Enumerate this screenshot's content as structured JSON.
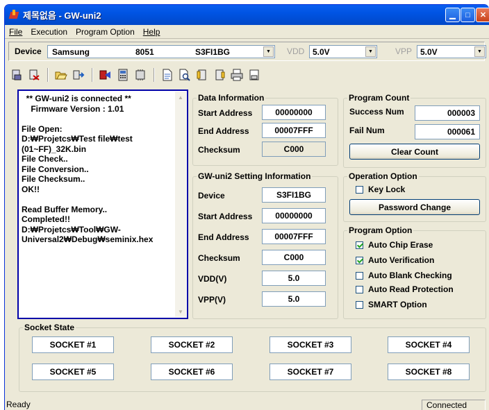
{
  "window": {
    "title": "제목없음 - GW-uni2"
  },
  "menu": [
    "File",
    "Execution",
    "Program Option",
    "Help"
  ],
  "device_bar": {
    "label": "Device",
    "manufacturer": "Samsung",
    "family": "8051",
    "device": "S3FI1BG",
    "vdd_label": "VDD",
    "vdd_value": "5.0V",
    "vpp_label": "VPP",
    "vpp_value": "5.0V"
  },
  "toolbar_icons": [
    "read-chip-icon",
    "erase-icon",
    "open-file-icon",
    "load-icon",
    "program-icon",
    "calculator-icon",
    "memory-icon",
    "document-icon",
    "search-doc-icon",
    "verify-icon",
    "protect-icon",
    "print-icon",
    "save-icon"
  ],
  "log": {
    "text": "  ** GW-uni2 is connected **\n    Firmware Version : 1.01\n\nFile Open:\nD:₩Projetcs₩Test file₩test\n(01~FF)_32K.bin\nFile Check..\nFile Conversion..\nFile Checksum..\nOK!!\n\nRead Buffer Memory..\nCompleted!!\nD:₩Projetcs₩Tool₩GW-\nUniversal2₩Debug₩seminix.hex"
  },
  "data_info": {
    "title": "Data Information",
    "start_label": "Start Address",
    "start_value": "00000000",
    "end_label": "End Address",
    "end_value": "00007FFF",
    "checksum_label": "Checksum",
    "checksum_value": "C000"
  },
  "settings": {
    "title": "GW-uni2 Setting Information",
    "device_label": "Device",
    "device_value": "S3FI1BG",
    "start_label": "Start Address",
    "start_value": "00000000",
    "end_label": "End Address",
    "end_value": "00007FFF",
    "checksum_label": "Checksum",
    "checksum_value": "C000",
    "vdd_label": "VDD(V)",
    "vdd_value": "5.0",
    "vpp_label": "VPP(V)",
    "vpp_value": "5.0"
  },
  "program_count": {
    "title": "Program Count",
    "success_label": "Success Num",
    "success_value": "000003",
    "fail_label": "Fail Num",
    "fail_value": "000061",
    "clear_label": "Clear Count"
  },
  "operation": {
    "title": "Operation Option",
    "key_lock": "Key Lock",
    "password_change": "Password Change"
  },
  "program_option": {
    "title": "Program Option",
    "items": [
      {
        "label": "Auto Chip Erase",
        "checked": true
      },
      {
        "label": "Auto Verification",
        "checked": true
      },
      {
        "label": "Auto Blank Checking",
        "checked": false
      },
      {
        "label": "Auto Read Protection",
        "checked": false
      },
      {
        "label": "SMART Option",
        "checked": false
      }
    ]
  },
  "socket_state": {
    "title": "Socket State",
    "sockets": [
      "SOCKET #1",
      "SOCKET #2",
      "SOCKET #3",
      "SOCKET #4",
      "SOCKET #5",
      "SOCKET #6",
      "SOCKET #7",
      "SOCKET #8"
    ]
  },
  "status": {
    "left": "Ready",
    "right": "Connected"
  }
}
